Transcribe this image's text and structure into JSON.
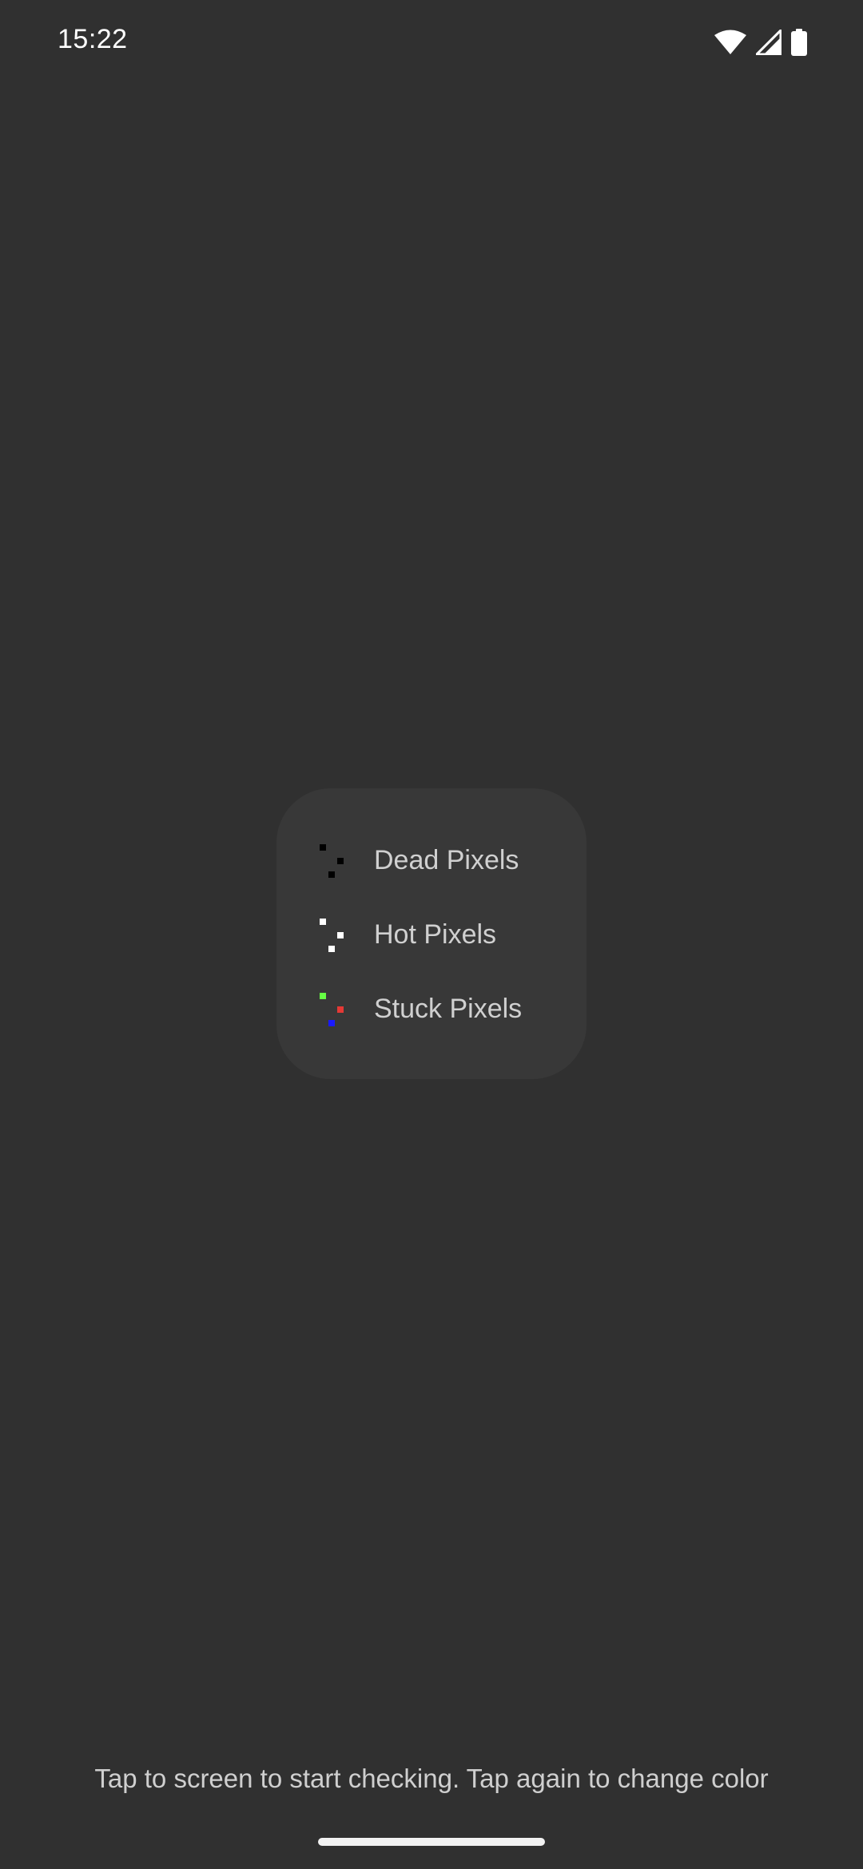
{
  "status_bar": {
    "time": "15:22",
    "icons": [
      "wifi-icon",
      "cellular-signal-icon",
      "battery-icon"
    ]
  },
  "legend": {
    "items": [
      {
        "label": "Dead Pixels",
        "pixel_colors": [
          "#000000",
          "#000000",
          "#000000"
        ]
      },
      {
        "label": "Hot Pixels",
        "pixel_colors": [
          "#ffffff",
          "#ffffff",
          "#ffffff"
        ]
      },
      {
        "label": "Stuck Pixels",
        "pixel_colors": [
          "#66ff44",
          "#e53935",
          "#1a1aff"
        ]
      }
    ]
  },
  "hint": "Tap to screen to start checking. Tap again to change color",
  "colors": {
    "background": "#303030",
    "card": "#383838",
    "text": "#d0d0d0"
  }
}
